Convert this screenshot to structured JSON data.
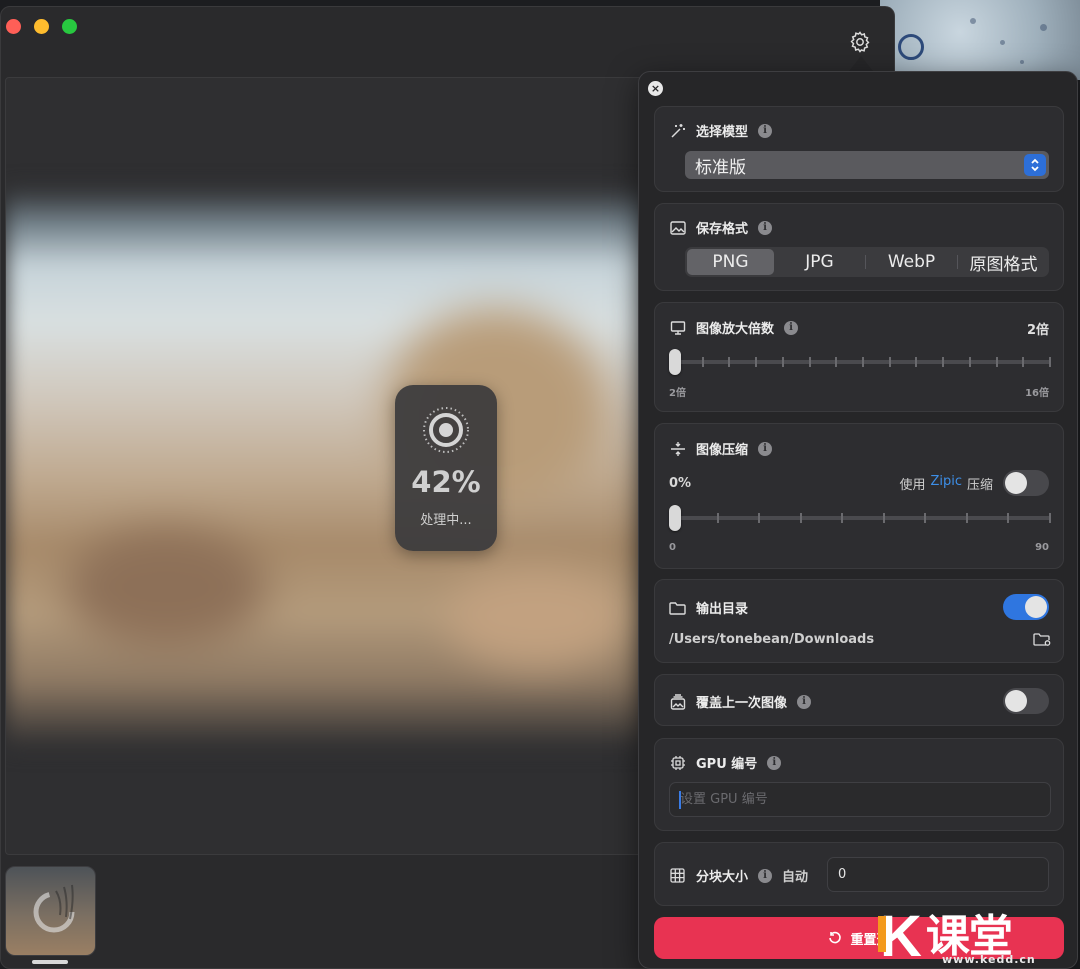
{
  "window": {
    "traffic_lights": [
      "close",
      "minimize",
      "maximize"
    ],
    "settings_icon": "gear-icon"
  },
  "preview": {
    "progress_percent": "42%",
    "progress_value": 0.42,
    "status_text": "处理中..."
  },
  "settings": {
    "close_icon": "close-icon",
    "model": {
      "label": "选择模型",
      "info": "i",
      "selected": "标准版"
    },
    "format": {
      "label": "保存格式",
      "info": "i",
      "options": [
        "PNG",
        "JPG",
        "WebP",
        "原图格式"
      ],
      "selected_index": 0
    },
    "scale": {
      "label": "图像放大倍数",
      "info": "i",
      "value": "2倍",
      "min_label": "2倍",
      "max_label": "16倍",
      "min": 2,
      "max": 16,
      "current": 2
    },
    "compress": {
      "label": "图像压缩",
      "info": "i",
      "value": "0%",
      "zipic_prefix": "使用",
      "zipic_name": "Zipic",
      "zipic_suffix": "压缩",
      "zipic_enabled": false,
      "min_label": "0",
      "max_label": "90",
      "min": 0,
      "max": 90,
      "current": 0
    },
    "output": {
      "label": "输出目录",
      "enabled": true,
      "path": "/Users/tonebean/Downloads"
    },
    "overwrite": {
      "label": "覆盖上一次图像",
      "info": "i",
      "enabled": false
    },
    "gpu": {
      "label": "GPU 编号",
      "info": "i",
      "placeholder": "设置 GPU 编号",
      "value": ""
    },
    "tile": {
      "label": "分块大小",
      "info": "i",
      "auto_label": "自动",
      "value": "0"
    },
    "reset_label": "重置选"
  },
  "watermark": {
    "brand": "课堂",
    "url": "www.kedd.cn"
  },
  "colors": {
    "accent_blue": "#2f76e0",
    "reset_red": "#e83352",
    "zipic_link": "#3d8fe8"
  }
}
